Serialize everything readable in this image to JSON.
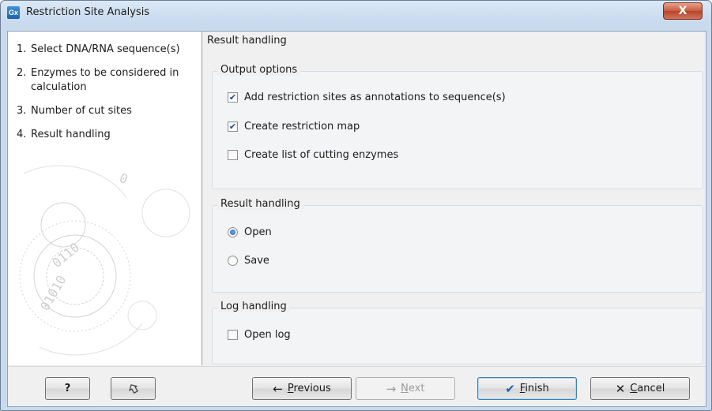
{
  "window": {
    "title": "Restriction Site Analysis",
    "app_icon_text": "Gx",
    "close_glyph": "X"
  },
  "steps": [
    {
      "num": "1.",
      "label": "Select DNA/RNA sequence(s)"
    },
    {
      "num": "2.",
      "label": "Enzymes to be considered in calculation"
    },
    {
      "num": "3.",
      "label": "Number of cut sites"
    },
    {
      "num": "4.",
      "label": "Result handling"
    }
  ],
  "panel": {
    "heading": "Result handling",
    "output_options": {
      "title": "Output options",
      "options": [
        {
          "label": "Add restriction sites as annotations to sequence(s)",
          "checked": true
        },
        {
          "label": "Create restriction map",
          "checked": true
        },
        {
          "label": "Create list of cutting enzymes",
          "checked": false
        }
      ]
    },
    "result_handling": {
      "title": "Result handling",
      "options": [
        {
          "label": "Open",
          "selected": true
        },
        {
          "label": "Save",
          "selected": false
        }
      ]
    },
    "log_handling": {
      "title": "Log handling",
      "options": [
        {
          "label": "Open log",
          "checked": false
        }
      ]
    }
  },
  "footer": {
    "help_label": "?",
    "previous": {
      "mnemonic": "P",
      "rest": "revious"
    },
    "next": {
      "mnemonic": "N",
      "rest": "ext"
    },
    "finish": {
      "mnemonic": "F",
      "rest": "inish"
    },
    "cancel": {
      "mnemonic": "C",
      "rest": "ancel"
    }
  },
  "colors": {
    "accent": "#3c7fb1",
    "check_mark": "#2b4c8c",
    "close_button": "#c75a3e"
  }
}
